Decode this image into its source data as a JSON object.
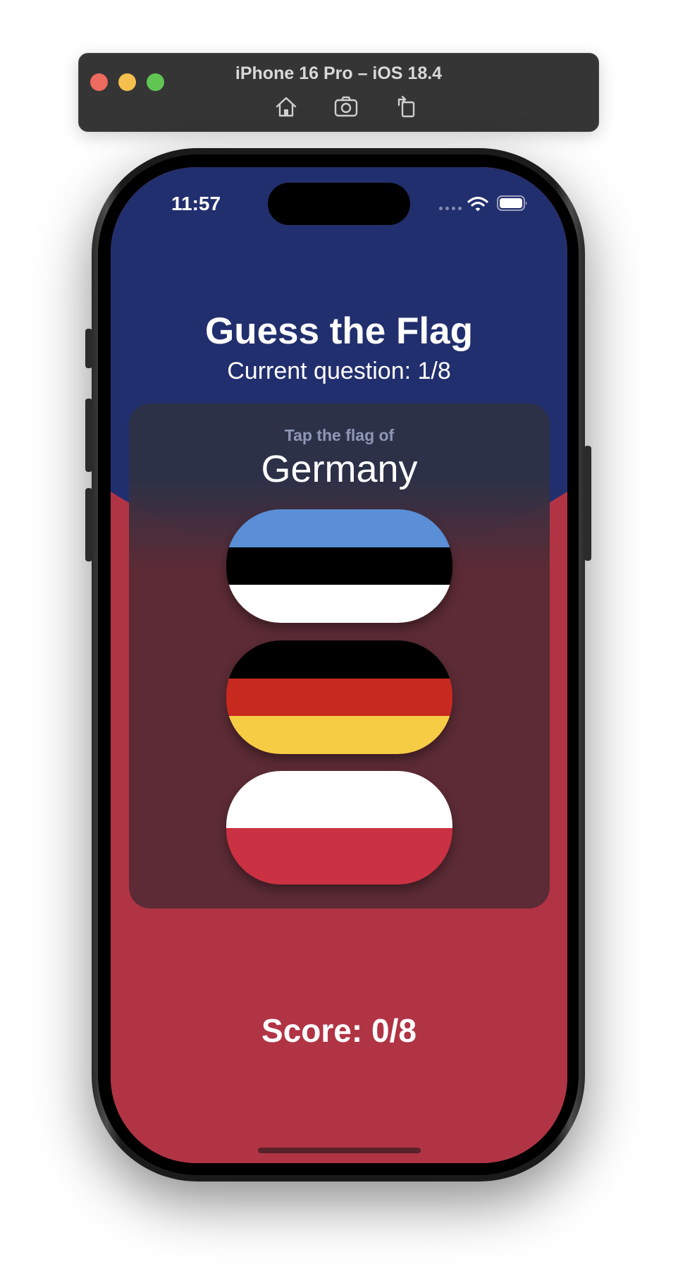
{
  "simulator": {
    "title": "iPhone 16 Pro – iOS 18.4",
    "toolbar_icons": [
      "home-icon",
      "screenshot-icon",
      "rotate-icon"
    ]
  },
  "status_bar": {
    "time": "11:57",
    "icons": [
      "cellular-signal-icon",
      "wifi-icon",
      "battery-icon"
    ]
  },
  "header": {
    "title": "Guess the Flag",
    "subtitle": "Current question: 1/8"
  },
  "card": {
    "prompt": "Tap the flag of",
    "country": "Germany"
  },
  "flags": [
    {
      "country": "Estonia",
      "stripes": [
        "#5a8ed7",
        "#000000",
        "#ffffff"
      ]
    },
    {
      "country": "Germany",
      "stripes": [
        "#000000",
        "#c8291f",
        "#f7cc45"
      ]
    },
    {
      "country": "Poland",
      "stripes": [
        "#ffffff",
        "#ca3142"
      ]
    }
  ],
  "footer": {
    "score": "Score: 0/8"
  },
  "colors": {
    "top_background": "#222f6e",
    "bottom_background": "#b13445",
    "card_top": "#2c3146",
    "card_bottom": "#5c2b35"
  }
}
